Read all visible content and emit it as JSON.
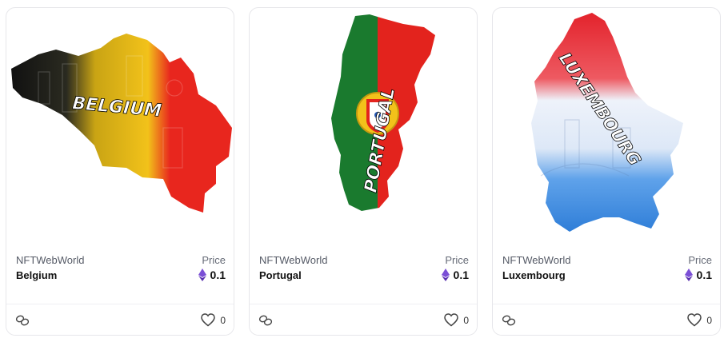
{
  "cards": [
    {
      "creator": "NFTWebWorld",
      "name": "Belgium",
      "price_label": "Price",
      "price": "0.1",
      "currency_icon": "ethereum-icon",
      "likes": "0",
      "map_text": "BELGIUM",
      "colors": [
        "#111111",
        "#f2c21a",
        "#e8261e"
      ]
    },
    {
      "creator": "NFTWebWorld",
      "name": "Portugal",
      "price_label": "Price",
      "price": "0.1",
      "currency_icon": "ethereum-icon",
      "likes": "0",
      "map_text": "PORTUGAL",
      "colors": [
        "#1a7a2e",
        "#e3231d",
        "#f2c21a"
      ]
    },
    {
      "creator": "NFTWebWorld",
      "name": "Luxembourg",
      "price_label": "Price",
      "price": "0.1",
      "currency_icon": "ethereum-icon",
      "likes": "0",
      "map_text": "LUXEMBOURG",
      "colors": [
        "#e3232c",
        "#ffffff",
        "#3f8fe0"
      ]
    }
  ],
  "footer_icons": [
    "link-icon",
    "heart-icon"
  ]
}
